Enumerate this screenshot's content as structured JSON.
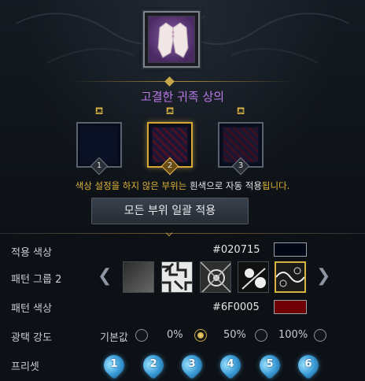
{
  "item": {
    "name": "고결한 귀족 상의",
    "icon": "noble-top-icon"
  },
  "parts": [
    {
      "number": "1",
      "color": "#0b1225",
      "active": false
    },
    {
      "number": "2",
      "color": "#2a1530",
      "active": true
    },
    {
      "number": "3",
      "color": "#2a1020",
      "active": false
    }
  ],
  "notice": {
    "part1": "색상 설정을 하지 않은 부위는 ",
    "part2": "흰색",
    "part3": "으로 자동 적용",
    "part4": "됩니다."
  },
  "apply_all_label": "모든 부위 일괄 적용",
  "apply_color": {
    "label": "적용 색상",
    "hex": "#020715",
    "swatch": "#020715"
  },
  "pattern_group": {
    "label": "패턴 그룹 2",
    "patterns": [
      "gradient-pattern",
      "maze-pattern",
      "ornate-pattern",
      "floral-pattern",
      "lace-pattern"
    ],
    "selected_index": 4
  },
  "pattern_color": {
    "label": "패턴 색상",
    "hex": "#6F0005",
    "swatch": "#6F0005"
  },
  "gloss": {
    "label": "광택 강도",
    "options": [
      "기본값",
      "0%",
      "50%",
      "100%"
    ],
    "selected_index": 1
  },
  "preset": {
    "label": "프리셋",
    "items": [
      "1",
      "2",
      "3",
      "4",
      "5",
      "6"
    ]
  },
  "colors": {
    "accent_gold": "#d6a63a",
    "title_purple": "#b978e6",
    "notice_yellow": "#e0b437",
    "preset_blue": "#3a9bd6"
  }
}
